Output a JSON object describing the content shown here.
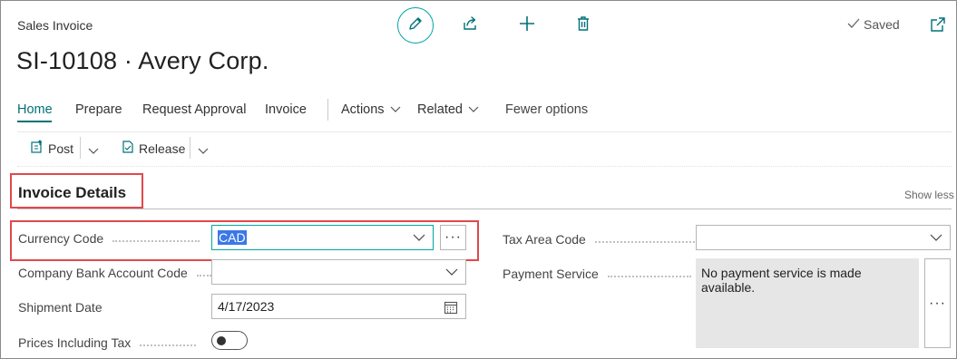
{
  "header": {
    "caption": "Sales Invoice",
    "title": "SI-10108 · Avery Corp.",
    "saved_label": "Saved"
  },
  "nav": {
    "home": "Home",
    "prepare": "Prepare",
    "request_approval": "Request Approval",
    "invoice": "Invoice",
    "actions": "Actions",
    "related": "Related",
    "fewer_options": "Fewer options"
  },
  "toolbar": {
    "post": "Post",
    "release": "Release"
  },
  "section": {
    "title": "Invoice Details",
    "show_less": "Show less"
  },
  "fields": {
    "currency_code": {
      "label": "Currency Code",
      "value": "CAD"
    },
    "company_bank_account_code": {
      "label": "Company Bank Account Code",
      "value": ""
    },
    "shipment_date": {
      "label": "Shipment Date",
      "value": "4/17/2023"
    },
    "prices_including_tax": {
      "label": "Prices Including Tax",
      "value": false
    },
    "tax_area_code": {
      "label": "Tax Area Code",
      "value": ""
    },
    "payment_service": {
      "label": "Payment Service",
      "value": "No payment service is made available."
    }
  },
  "colors": {
    "accent": "#00717a",
    "focus": "#00a6a6",
    "highlight": "#e0494c",
    "selection": "#3b78e7"
  },
  "icons": [
    "edit-icon",
    "share-icon",
    "plus-icon",
    "trash-icon",
    "check-icon",
    "popout-icon",
    "post-icon",
    "release-icon",
    "chevron-down-icon",
    "calendar-icon"
  ]
}
